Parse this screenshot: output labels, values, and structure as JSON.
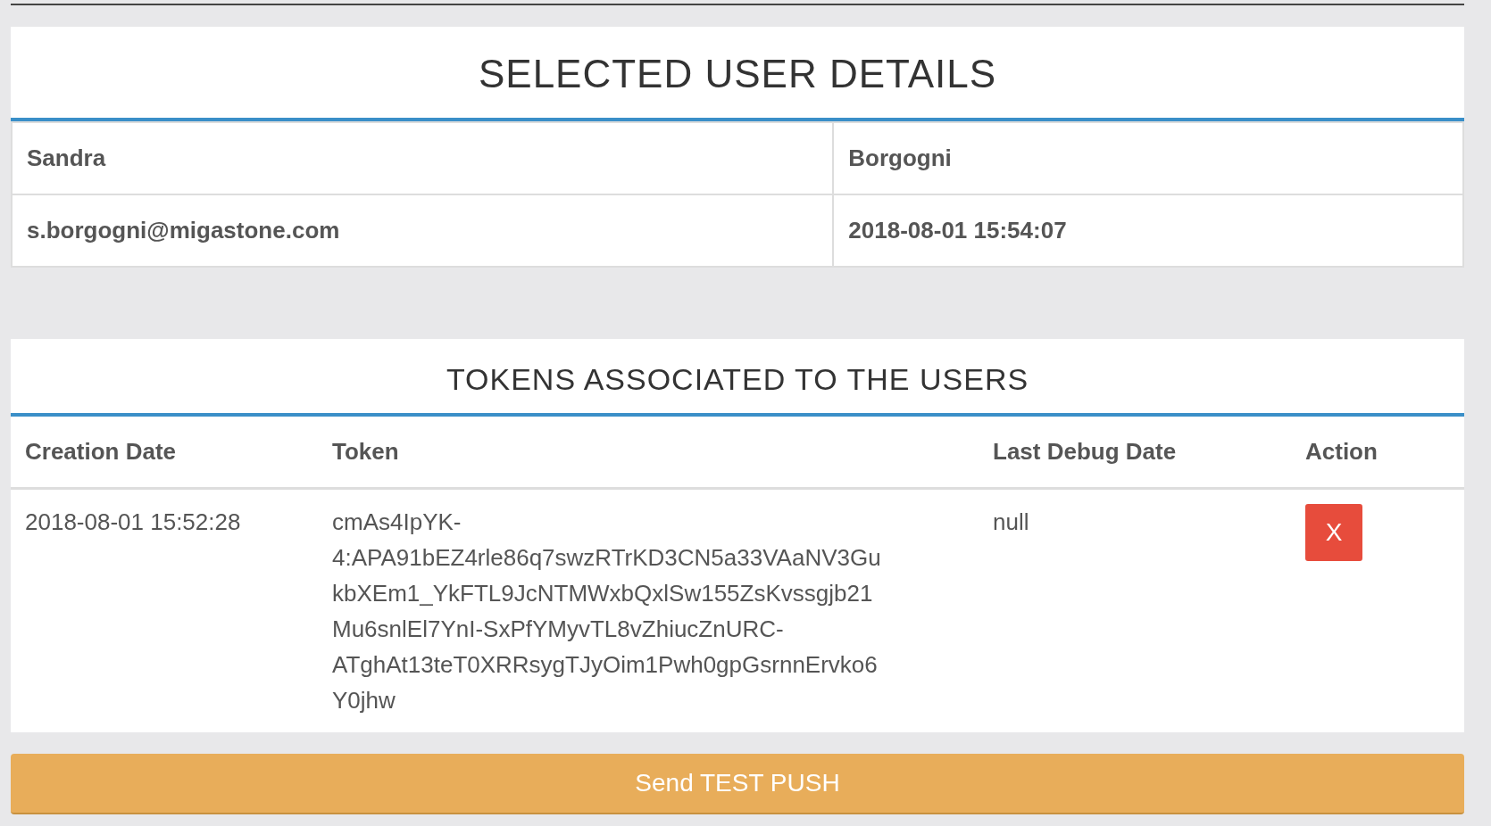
{
  "user_details": {
    "title": "SELECTED USER DETAILS",
    "rows": [
      [
        "Sandra",
        "Borgogni"
      ],
      [
        "s.borgogni@migastone.com",
        "2018-08-01 15:54:07"
      ]
    ]
  },
  "tokens": {
    "title": "TOKENS ASSOCIATED TO THE USERS",
    "columns": [
      "Creation Date",
      "Token",
      "Last Debug Date",
      "Action"
    ],
    "rows": [
      {
        "creation_date": "2018-08-01 15:52:28",
        "token": "cmAs4IpYK-4:APA91bEZ4rle86q7swzRTrKD3CN5a33VAaNV3GukbXEm1_YkFTL9JcNTMWxbQxlSw155ZsKvssgjb21Mu6snlEl7YnI-SxPfYMyvTL8vZhiucZnURC-ATghAt13teT0XRRsygTJyOim1Pwh0gpGsrnnErvko6Y0jhw",
        "last_debug_date": "null",
        "action": "X"
      }
    ]
  },
  "push_button": "Send TEST PUSH"
}
